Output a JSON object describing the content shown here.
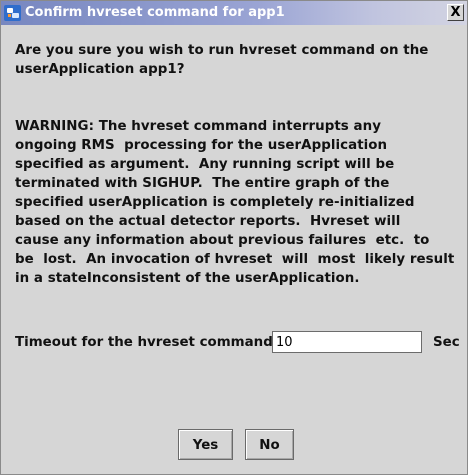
{
  "window": {
    "title": "Confirm hvreset command for app1",
    "close_glyph": "X"
  },
  "question_lines": [
    "Are you sure you wish to run hvreset command on the",
    "userApplication app1?"
  ],
  "warning_lines": [
    "WARNING: The hvreset command interrupts any",
    "ongoing RMS  processing for the userApplication",
    "specified as argument.  Any running script will be",
    "terminated with SIGHUP.  The entire graph of the",
    "specified userApplication is completely re-initialized",
    "based on the actual detector reports.  Hvreset will",
    "cause any information about previous failures  etc.  to",
    "be  lost.  An invocation of hvreset  will  most  likely result",
    "in a stateInconsistent of the userApplication."
  ],
  "timeout": {
    "label": "Timeout for the hvreset command :",
    "value": "10",
    "unit": "Sec"
  },
  "buttons": {
    "yes": "Yes",
    "no": "No"
  }
}
